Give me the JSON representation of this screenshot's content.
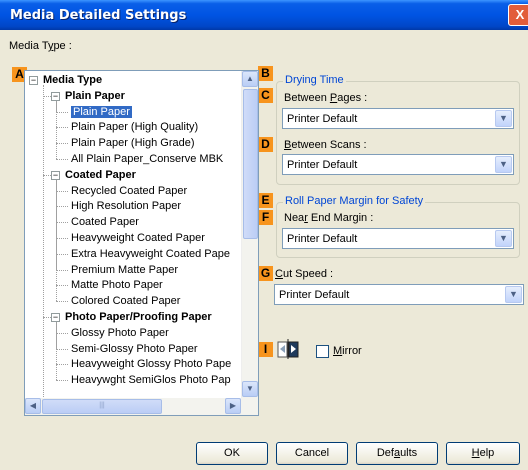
{
  "window": {
    "title": "Media Detailed Settings",
    "close_glyph": "X"
  },
  "media_type_label": "Media Type :",
  "badges": {
    "a": "A",
    "b": "B",
    "c": "C",
    "d": "D",
    "e": "E",
    "f": "F",
    "g": "G",
    "i": "I"
  },
  "tree": {
    "root": "Media Type",
    "items": [
      {
        "label": "Plain Paper",
        "level": 1
      },
      {
        "label": "Plain Paper",
        "level": 2,
        "selected": true
      },
      {
        "label": "Plain Paper (High Quality)",
        "level": 2
      },
      {
        "label": "Plain Paper (High Grade)",
        "level": 2
      },
      {
        "label": "All Plain Paper_Conserve MBK",
        "level": 2
      },
      {
        "label": "Coated Paper",
        "level": 1
      },
      {
        "label": "Recycled Coated Paper",
        "level": 2
      },
      {
        "label": "High Resolution Paper",
        "level": 2
      },
      {
        "label": "Coated Paper",
        "level": 2
      },
      {
        "label": "Heavyweight Coated Paper",
        "level": 2
      },
      {
        "label": "Extra Heavyweight Coated Pape",
        "level": 2
      },
      {
        "label": "Premium Matte Paper",
        "level": 2
      },
      {
        "label": "Matte Photo Paper",
        "level": 2
      },
      {
        "label": "Colored Coated Paper",
        "level": 2
      },
      {
        "label": "Photo Paper/Proofing Paper",
        "level": 1
      },
      {
        "label": "Glossy Photo Paper",
        "level": 2
      },
      {
        "label": "Semi-Glossy Photo Paper",
        "level": 2
      },
      {
        "label": "Heavyweight Glossy Photo Pape",
        "level": 2
      },
      {
        "label": "Heavywght SemiGlos Photo Pap",
        "level": 2
      }
    ]
  },
  "drying_time": {
    "title": "Drying Time",
    "between_pages_label": "Between Pages :",
    "between_pages_value": "Printer Default",
    "between_scans_label": "Between Scans :",
    "between_scans_value": "Printer Default"
  },
  "roll_margin": {
    "title": "Roll Paper Margin for Safety",
    "near_end_label": "Near End Margin :",
    "near_end_value": "Printer Default"
  },
  "cut_speed": {
    "label": "Cut Speed :",
    "value": "Printer Default"
  },
  "mirror": {
    "label": "Mirror",
    "checked": false
  },
  "buttons": {
    "ok": "OK",
    "cancel": "Cancel",
    "defaults": "Defaults",
    "help": "Help"
  },
  "colors": {
    "accent": "#0046d5",
    "badge": "#f7941d",
    "titlebar": "#0054e3",
    "selection": "#316ac5"
  }
}
